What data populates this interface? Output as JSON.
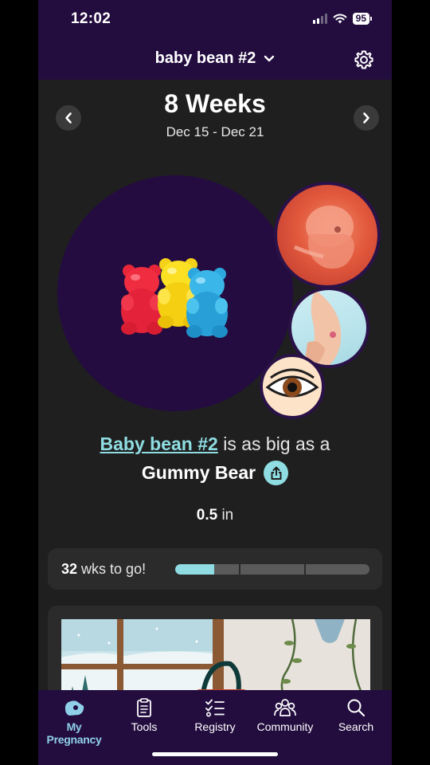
{
  "status_bar": {
    "time": "12:02",
    "battery": "95"
  },
  "header": {
    "profile_name": "baby bean #2"
  },
  "week": {
    "title": "8 Weeks",
    "date_range": "Dec 15 - Dec 21"
  },
  "size": {
    "baby_name": "Baby bean #2",
    "comparison_text": "is as big as a",
    "object": "Gummy Bear",
    "length_value": "0.5",
    "length_unit": "in"
  },
  "progress": {
    "weeks_left": "32",
    "label": "wks to go!",
    "fraction_complete": 0.2
  },
  "tabs": [
    {
      "label": "My Pregnancy",
      "icon": "pregnancy-icon",
      "active": true
    },
    {
      "label": "Tools",
      "icon": "clipboard-icon",
      "active": false
    },
    {
      "label": "Registry",
      "icon": "checklist-icon",
      "active": false
    },
    {
      "label": "Community",
      "icon": "community-icon",
      "active": false
    },
    {
      "label": "Search",
      "icon": "search-icon",
      "active": false
    }
  ],
  "colors": {
    "header_bg": "#230d3f",
    "accent": "#8fdde2",
    "screen_bg": "#1f1f1f"
  }
}
